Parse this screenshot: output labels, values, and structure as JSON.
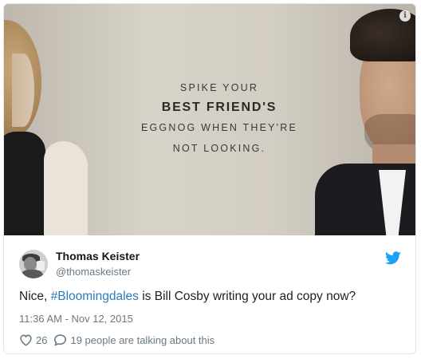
{
  "media": {
    "ad_line1": "SPIKE YOUR",
    "ad_line2": "BEST FRIEND'S",
    "ad_line3": "EGGNOG WHEN THEY'RE",
    "ad_line4": "NOT LOOKING.",
    "info_glyph": "i"
  },
  "user": {
    "name": "Thomas Keister",
    "handle": "@thomaskeister",
    "avatar_icon": "user-avatar"
  },
  "tweet": {
    "text_before": "Nice, ",
    "hashtag": "#Bloomingdales",
    "text_after": " is Bill Cosby writing your ad copy now?",
    "timestamp": "11:36 AM - Nov 12, 2015"
  },
  "actions": {
    "likes": "26",
    "talking": "19 people are talking about this"
  },
  "icons": {
    "bird": "twitter-bird-icon",
    "heart": "heart-icon",
    "reply": "reply-bubble-icon",
    "info": "info-icon"
  },
  "colors": {
    "brand": "#1da1f2",
    "hashtag": "#2b7bb9",
    "secondary_text": "#697882",
    "primary_text": "#1c2022"
  }
}
